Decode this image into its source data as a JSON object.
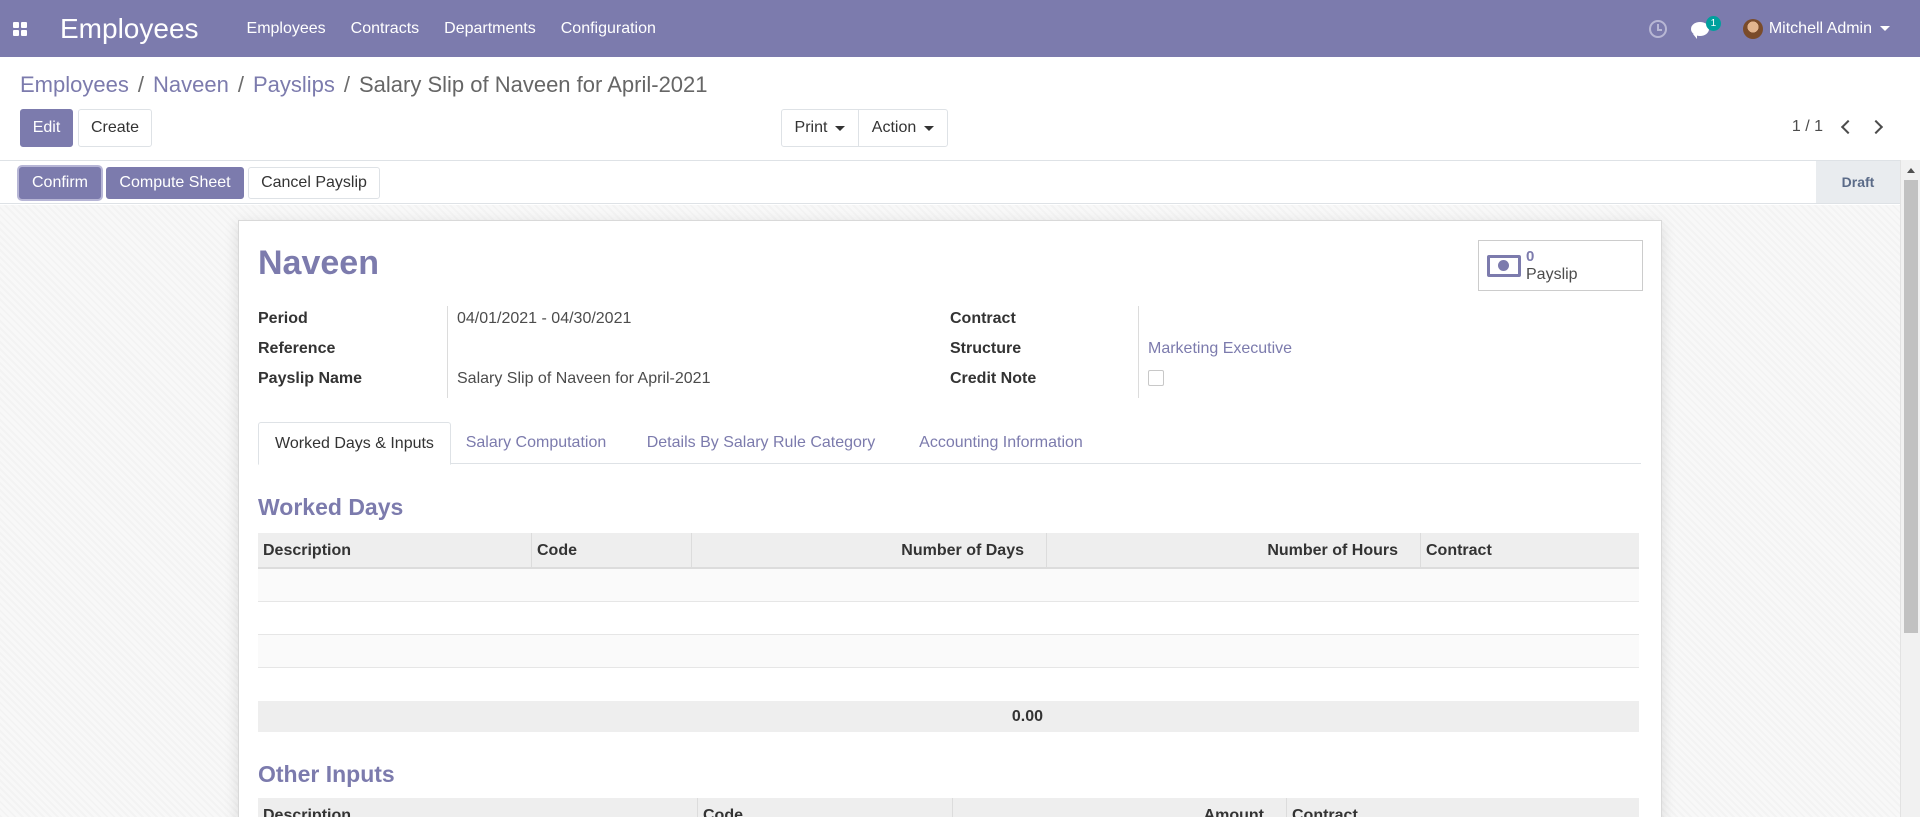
{
  "navbar": {
    "app_title": "Employees",
    "menu": [
      "Employees",
      "Contracts",
      "Departments",
      "Configuration"
    ],
    "chat_badge": "1",
    "user_name": "Mitchell Admin",
    "color": "#7c7bad"
  },
  "breadcrumb": {
    "items": [
      "Employees",
      "Naveen",
      "Payslips"
    ],
    "current": "Salary Slip of Naveen for April-2021",
    "separator": "/"
  },
  "control": {
    "edit_label": "Edit",
    "create_label": "Create",
    "print_label": "Print",
    "action_label": "Action",
    "pager": "1 / 1"
  },
  "statusbar": {
    "confirm_label": "Confirm",
    "compute_label": "Compute Sheet",
    "cancel_label": "Cancel Payslip",
    "stage": "Draft"
  },
  "form": {
    "smart_button": {
      "value": "0",
      "label": "Payslip",
      "icon": "money-icon"
    },
    "title": "Naveen",
    "left_fields": [
      {
        "label": "Period",
        "value": "04/01/2021 - 04/30/2021"
      },
      {
        "label": "Reference",
        "value": ""
      },
      {
        "label": "Payslip Name",
        "value": "Salary Slip of Naveen for April-2021"
      }
    ],
    "right_fields": [
      {
        "label": "Contract",
        "value": ""
      },
      {
        "label": "Structure",
        "value": "Marketing Executive"
      },
      {
        "label": "Credit Note",
        "value": ""
      }
    ],
    "credit_note_checked": false,
    "tabs": [
      "Worked Days & Inputs",
      "Salary Computation",
      "Details By Salary Rule Category",
      "Accounting Information"
    ],
    "active_tab": 0,
    "worked_days": {
      "title": "Worked Days",
      "columns": [
        "Description",
        "Code",
        "Number of Days",
        "Number of Hours",
        "Contract"
      ],
      "total": "0.00"
    },
    "other_inputs": {
      "title": "Other Inputs",
      "columns": [
        "Description",
        "Code",
        "Amount",
        "Contract"
      ]
    }
  }
}
